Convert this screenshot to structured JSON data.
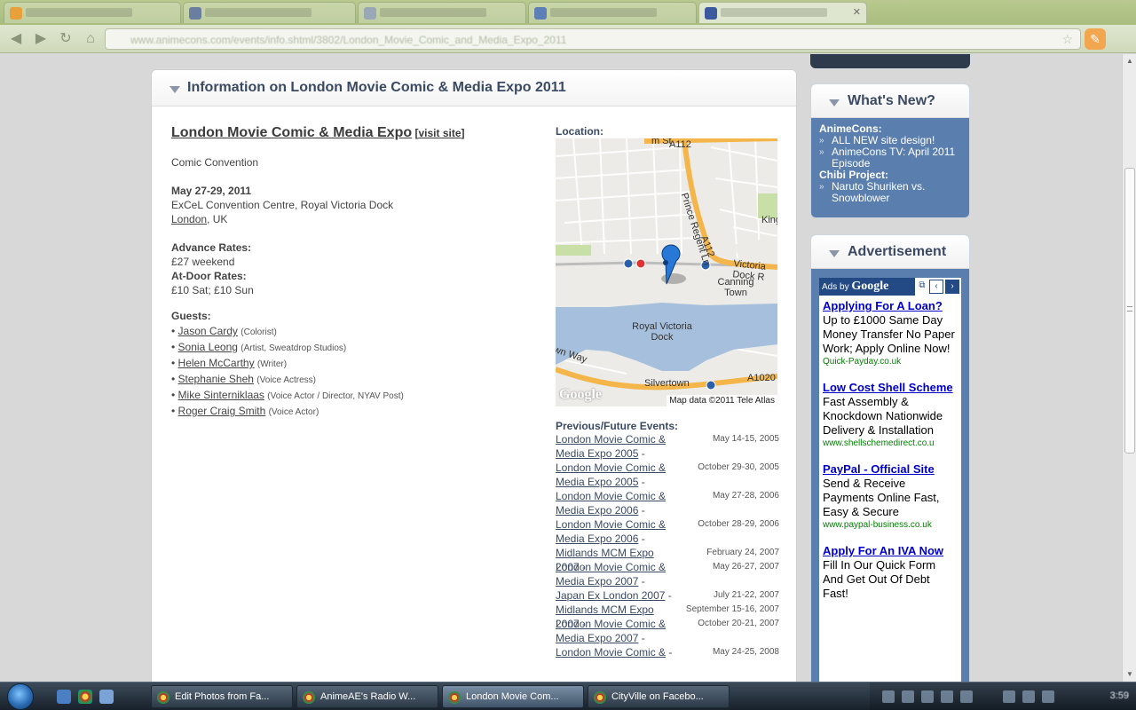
{
  "browser": {
    "tabs": [
      {
        "label": "Google Calendar",
        "active": false
      },
      {
        "label": "London Movie Comic",
        "active": false
      },
      {
        "label": "New Tab",
        "active": false
      },
      {
        "label": "History",
        "active": false
      },
      {
        "label": "London Movie Comic & Media Expo 2011",
        "active": true
      }
    ],
    "url": "www.animecons.com/events/info.shtml/3802/London_Movie_Comic_and_Media_Expo_2011"
  },
  "main": {
    "title": "Information on London Movie Comic & Media Expo 2011",
    "convention_name": "London Movie Comic & Media Expo",
    "visit_site": "visit site",
    "type": "Comic Convention",
    "dates": "May 27-29, 2011",
    "venue": "ExCeL Convention Centre, Royal Victoria Dock",
    "city": "London",
    "country": ", UK",
    "advance_rates_label": "Advance Rates:",
    "advance_rates": "£27 weekend",
    "atdoor_rates_label": "At-Door Rates:",
    "atdoor_rates": "£10 Sat; £10 Sun",
    "guests_label": "Guests:",
    "guests": [
      {
        "name": "Jason Cardy",
        "role": "(Colorist)"
      },
      {
        "name": "Sonia Leong",
        "role": "(Artist, Sweatdrop Studios)"
      },
      {
        "name": "Helen McCarthy",
        "role": "(Writer)"
      },
      {
        "name": "Stephanie Sheh",
        "role": "(Voice Actress)"
      },
      {
        "name": "Mike Sinterniklaas",
        "role": "(Voice Actor / Director, NYAV Post)"
      },
      {
        "name": "Roger Craig Smith",
        "role": "(Voice Actor)"
      }
    ],
    "location_label": "Location:",
    "map": {
      "labels": {
        "road_a112_top": "A112",
        "road_prince_regent": "Prince Regent Ln",
        "road_a112_side": "A112",
        "king": "King",
        "victoria_dock_rd": "Victoria Dock R",
        "canning_town": "Canning Town",
        "royal_victoria_dock": "Royal Victoria Dock",
        "silvertown": "Silvertown",
        "a1020": "A1020",
        "way": "wn Way",
        "st": "m St"
      },
      "google": "Google",
      "credit": "Map data ©2011 Tele Atlas",
      "colors": {
        "water": "#a5bfdd",
        "road": "#f4b54a",
        "park": "#c8dfa8"
      }
    },
    "events_label": "Previous/Future Events:",
    "events": [
      {
        "name": "London Movie Comic & Media Expo 2005",
        "date": "May 14-15, 2005"
      },
      {
        "name": "London Movie Comic & Media Expo 2005",
        "date": "October 29-30, 2005"
      },
      {
        "name": "London Movie Comic & Media Expo 2006",
        "date": "May 27-28, 2006"
      },
      {
        "name": "London Movie Comic & Media Expo 2006",
        "date": "October 28-29, 2006"
      },
      {
        "name": "Midlands MCM Expo 2007",
        "date": "February 24, 2007"
      },
      {
        "name": "London Movie Comic & Media Expo 2007",
        "date": "May 26-27, 2007"
      },
      {
        "name": "Japan Ex London 2007",
        "date": "July 21-22, 2007"
      },
      {
        "name": "Midlands MCM Expo 2007",
        "date": "September 15-16, 2007"
      },
      {
        "name": "London Movie Comic & Media Expo 2007",
        "date": "October 20-21, 2007"
      },
      {
        "name": "London Movie Comic &",
        "date": "May 24-25, 2008"
      }
    ]
  },
  "sidebar": {
    "whats_new": {
      "title": "What's New?",
      "groups": [
        {
          "category": "AnimeCons:",
          "items": [
            "ALL NEW site design!",
            "AnimeCons TV: April 2011 Episode"
          ]
        },
        {
          "category": "Chibi Project:",
          "items": [
            "Naruto Shuriken vs. Snowblower"
          ]
        }
      ]
    },
    "advertisement": {
      "title": "Advertisement",
      "ads_by": "Ads by",
      "google": "Google",
      "ads": [
        {
          "title": "Applying For A Loan?",
          "text": "Up to £1000 Same Day Money Transfer No Paper Work; Apply Online Now!",
          "url": "Quick-Payday.co.uk"
        },
        {
          "title": "Low Cost Shell Scheme",
          "text": "Fast Assembly & Knockdown Nationwide Delivery & Installation",
          "url": "www.shellschemedirect.co.u"
        },
        {
          "title": "PayPal - Official Site",
          "text": "Send & Receive Payments Online Fast, Easy & Secure",
          "url": "www.paypal-business.co.uk"
        },
        {
          "title": "Apply For An IVA Now",
          "text": "Fill In Our Quick Form And Get Out Of Debt Fast!",
          "url": ""
        }
      ]
    }
  },
  "taskbar": {
    "tasks": [
      {
        "label": "Edit Photos from Fa...",
        "active": false
      },
      {
        "label": "AnimeAE's Radio W...",
        "active": false
      },
      {
        "label": "London Movie Com...",
        "active": true
      },
      {
        "label": "CityVille on Facebo...",
        "active": false
      }
    ],
    "clock": "3:59"
  }
}
